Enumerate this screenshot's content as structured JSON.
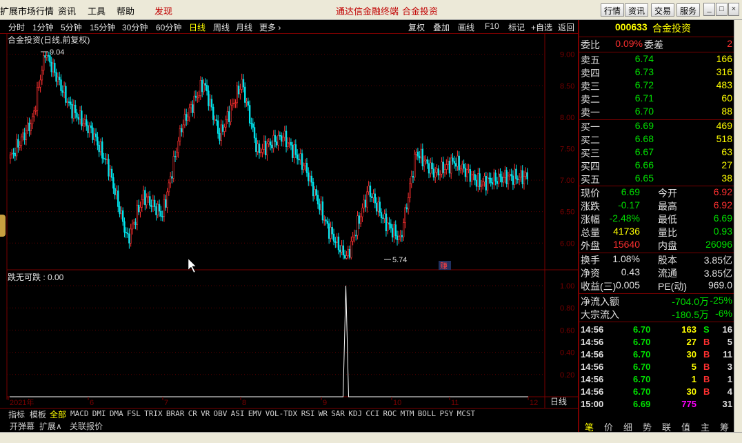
{
  "menubar": {
    "items": [
      "扩展市场行情",
      "资讯",
      "工具",
      "帮助"
    ],
    "discover": "发现",
    "center_links": [
      "通达信金融终端",
      "合金投资"
    ],
    "right_buttons": [
      "行情",
      "资讯",
      "交易",
      "服务"
    ]
  },
  "periodbar": {
    "periods": [
      "分时",
      "1分钟",
      "5分钟",
      "15分钟",
      "30分钟",
      "60分钟",
      "日线",
      "周线",
      "月线",
      "更多 ›"
    ],
    "active": "日线",
    "tools": [
      "复权",
      "叠加",
      "画线",
      "F10",
      "标记",
      "+自选",
      "返回"
    ]
  },
  "chart": {
    "title": "合金投资(日线,前复权)",
    "high_label": "9.04",
    "low_label": "5.74",
    "marker": "赚",
    "indicator_title": "跌无可跌 : 0.00",
    "period_label": "日线",
    "zoom": [
      "+",
      "-",
      "0"
    ],
    "colors": {
      "up": "#ff3030",
      "down": "#00e5ee",
      "axis": "#7a0000",
      "grid": "#5a0000",
      "text": "#c0c0c0"
    }
  },
  "chart_data": [
    {
      "type": "candlestick",
      "y_axis": [
        "9.00",
        "8.50",
        "8.00",
        "7.50",
        "7.00",
        "6.50",
        "6.00"
      ],
      "ylim": [
        5.74,
        9.04
      ],
      "x_labels": [
        "2021年",
        "6",
        "7",
        "8",
        "9",
        "10",
        "11",
        "12"
      ],
      "high": 9.04,
      "low": 5.74
    },
    {
      "type": "line",
      "y_axis": [
        "1.00",
        "0.80",
        "0.60",
        "0.40",
        "0.20"
      ],
      "ylim": [
        0,
        1
      ],
      "name": "跌无可跌",
      "spike_month": "10"
    }
  ],
  "indbar": {
    "left": [
      "指标",
      "模板"
    ],
    "items": [
      "全部",
      "MACD",
      "DMI",
      "DMA",
      "FSL",
      "TRIX",
      "BRAR",
      "CR",
      "VR",
      "OBV",
      "ASI",
      "EMV",
      "VOL-TDX",
      "RSI",
      "WR",
      "SAR",
      "KDJ",
      "CCI",
      "ROC",
      "MTM",
      "BOLL",
      "PSY",
      "MCST"
    ],
    "active": "全部"
  },
  "bottombar": [
    "开弹幕",
    "扩展∧",
    "关联报价"
  ],
  "quote": {
    "code": "000633",
    "name": "合金投资",
    "weibi_label": "委比",
    "weibi": "0.09%",
    "weicha_label": "委差",
    "weicha": "2",
    "sell": [
      {
        "label": "卖五",
        "price": "6.74",
        "vol": "166"
      },
      {
        "label": "卖四",
        "price": "6.73",
        "vol": "316"
      },
      {
        "label": "卖三",
        "price": "6.72",
        "vol": "483"
      },
      {
        "label": "卖二",
        "price": "6.71",
        "vol": "60"
      },
      {
        "label": "卖一",
        "price": "6.70",
        "vol": "88"
      }
    ],
    "buy": [
      {
        "label": "买一",
        "price": "6.69",
        "vol": "469"
      },
      {
        "label": "买二",
        "price": "6.68",
        "vol": "518"
      },
      {
        "label": "买三",
        "price": "6.67",
        "vol": "63"
      },
      {
        "label": "买四",
        "price": "6.66",
        "vol": "27"
      },
      {
        "label": "买五",
        "price": "6.65",
        "vol": "38"
      }
    ],
    "stats": [
      {
        "l1": "现价",
        "v1": "6.69",
        "c1": "green",
        "l2": "今开",
        "v2": "6.92",
        "c2": "red"
      },
      {
        "l1": "涨跌",
        "v1": "-0.17",
        "c1": "green",
        "l2": "最高",
        "v2": "6.92",
        "c2": "red"
      },
      {
        "l1": "涨幅",
        "v1": "-2.48%",
        "c1": "green",
        "l2": "最低",
        "v2": "6.69",
        "c2": "green"
      },
      {
        "l1": "总量",
        "v1": "41736",
        "c1": "yellow",
        "l2": "量比",
        "v2": "0.93",
        "c2": "green"
      },
      {
        "l1": "外盘",
        "v1": "15640",
        "c1": "red",
        "l2": "内盘",
        "v2": "26096",
        "c2": "green"
      }
    ],
    "fund": [
      {
        "l1": "换手",
        "v1": "1.08%",
        "l2": "股本",
        "v2": "3.85亿"
      },
      {
        "l1": "净资",
        "v1": "0.43",
        "l2": "流通",
        "v2": "3.85亿"
      },
      {
        "l1": "收益(三)",
        "v1": "0.005",
        "l2": "PE(动)",
        "v2": "969.0"
      }
    ],
    "flow": [
      {
        "label": "净流入额",
        "value": "-704.0万",
        "pct": "-25%"
      },
      {
        "label": "大宗流入",
        "value": "-180.5万",
        "pct": "-6%"
      }
    ],
    "ticks": [
      {
        "time": "14:56",
        "price": "6.70",
        "vol": "163",
        "side": "S",
        "n": "16"
      },
      {
        "time": "14:56",
        "price": "6.70",
        "vol": "27",
        "side": "B",
        "n": "5"
      },
      {
        "time": "14:56",
        "price": "6.70",
        "vol": "30",
        "side": "B",
        "n": "11"
      },
      {
        "time": "14:56",
        "price": "6.70",
        "vol": "5",
        "side": "B",
        "n": "3"
      },
      {
        "time": "14:56",
        "price": "6.70",
        "vol": "1",
        "side": "B",
        "n": "1"
      },
      {
        "time": "14:56",
        "price": "6.70",
        "vol": "30",
        "side": "B",
        "n": "4"
      },
      {
        "time": "15:00",
        "price": "6.69",
        "vol": "775",
        "side": "",
        "n": "31"
      }
    ],
    "tabs": [
      "笔",
      "价",
      "细",
      "势",
      "联",
      "值",
      "主",
      "筹"
    ],
    "active_tab": "笔"
  }
}
